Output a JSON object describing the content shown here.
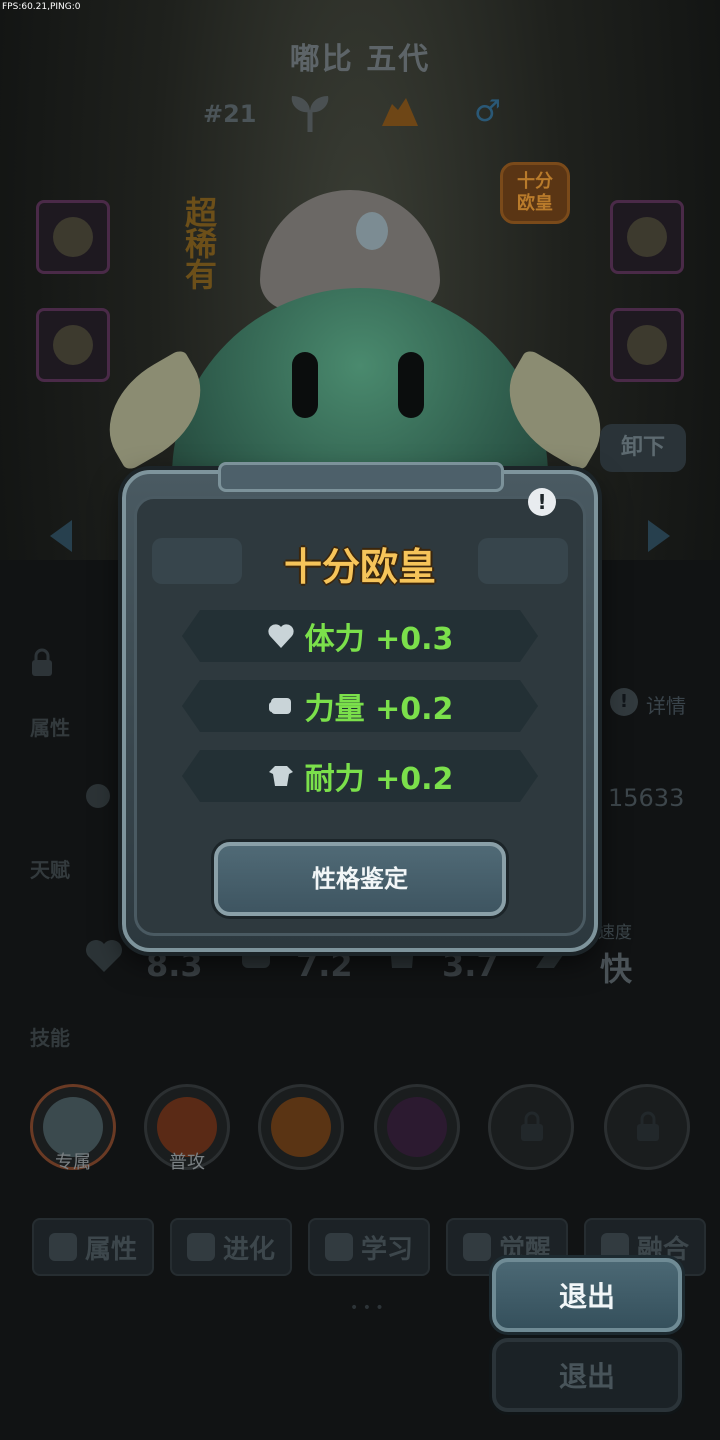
{
  "debug": {
    "fps": "FPS:60.21,PING:0"
  },
  "pet": {
    "name": "嘟比 五代",
    "number": "#21",
    "rarity": "超\n稀\n有",
    "badge": "十分\n欧皇",
    "unload_label": "卸下"
  },
  "page": {
    "attributes_label": "属性",
    "detail_label": "详情",
    "power": "15633",
    "talent_label": "天赋",
    "skills_label": "技能",
    "stats": {
      "hp": "8.3",
      "strength": "7.2",
      "endurance": "3.7",
      "speed_label": "速度",
      "speed": "快"
    },
    "skills": [
      {
        "label": "专属"
      },
      {
        "label": "普攻"
      }
    ],
    "tabs": [
      {
        "label": "属性"
      },
      {
        "label": "进化"
      },
      {
        "label": "学习"
      },
      {
        "label": "觉醒"
      },
      {
        "label": "融合"
      }
    ],
    "page_dots": "• • •"
  },
  "popup": {
    "title": "十分欧皇",
    "alert": "!",
    "rows": [
      {
        "icon": "heart-icon",
        "text": "体力 +0.3"
      },
      {
        "icon": "fist-icon",
        "text": "力量 +0.2"
      },
      {
        "icon": "armor-icon",
        "text": "耐力 +0.2"
      }
    ],
    "appraise_button": "性格鉴定"
  },
  "exit": {
    "primary_label": "退出",
    "secondary_label": "退出"
  },
  "colors": {
    "title_gold": "#f6c45a",
    "stat_green": "#7be04b",
    "popup_border": "#7e949c"
  }
}
